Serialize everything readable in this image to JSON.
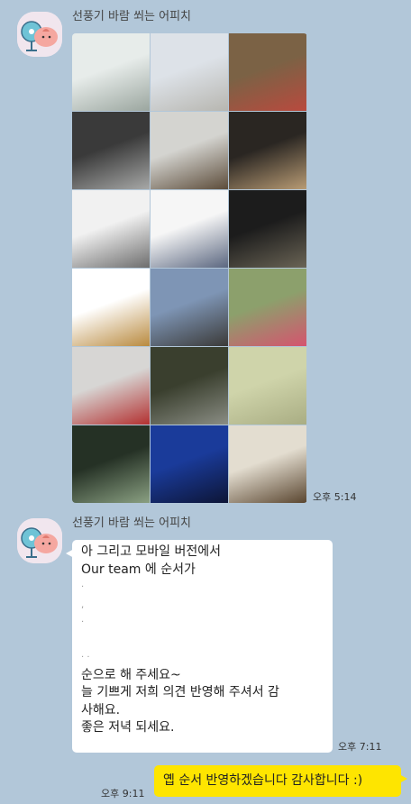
{
  "messages": [
    {
      "sender": "선풍기 바람 쐬는 어피치",
      "avatar_icon": "apeach-fan-icon",
      "time": "오후 5:14",
      "photos": [
        {
          "name": "birds-sky-photo",
          "c1": "#e7ecea",
          "c2": "#9ba69f"
        },
        {
          "name": "cloudy-rooftop-photo",
          "c1": "#dde2e8",
          "c2": "#b7b6b0"
        },
        {
          "name": "window-shutter-photo",
          "c1": "#7b6245",
          "c2": "#b94a3e"
        },
        {
          "name": "gallery-wall-photo",
          "c1": "#3a3a3a",
          "c2": "#a7a8a7"
        },
        {
          "name": "head-sculpture-photo",
          "c1": "#d4d4d0",
          "c2": "#5c4c3a"
        },
        {
          "name": "hand-dark-photo",
          "c1": "#2a2622",
          "c2": "#b89b74"
        },
        {
          "name": "snow-lines-photo",
          "c1": "#f1f1f1",
          "c2": "#6d6d6d"
        },
        {
          "name": "snow-field-photo",
          "c1": "#f6f6f6",
          "c2": "#5b6780"
        },
        {
          "name": "dark-hall-photo",
          "c1": "#1c1c1c",
          "c2": "#6a6455"
        },
        {
          "name": "sand-horizon-photo",
          "c1": "#ffffff",
          "c2": "#b98a3f"
        },
        {
          "name": "aerial-city-photo",
          "c1": "#7e95b5",
          "c2": "#3b3a38"
        },
        {
          "name": "flowers-photo",
          "c1": "#8ca06c",
          "c2": "#d5546f"
        },
        {
          "name": "red-mailbox-photo",
          "c1": "#d7d6d4",
          "c2": "#b33030"
        },
        {
          "name": "forest-bench-photo",
          "c1": "#3a3f2e",
          "c2": "#8a8d84"
        },
        {
          "name": "pale-field-photo",
          "c1": "#cfd4aa",
          "c2": "#a9ad83"
        },
        {
          "name": "bamboo-forest-photo",
          "c1": "#253125",
          "c2": "#8aa082"
        },
        {
          "name": "night-buildings-photo",
          "c1": "#1a3b9a",
          "c2": "#0d1536"
        },
        {
          "name": "rocky-ground-photo",
          "c1": "#e3ddd0",
          "c2": "#5a4630"
        }
      ]
    },
    {
      "sender": "선풍기 바람 쐬는 어피치",
      "avatar_icon": "apeach-fan-icon",
      "time": "오후 7:11",
      "lines": [
        "아 그리고 모바일 버전에서",
        "Our team 에 순서가",
        "·",
        ",",
        "·",
        "",
        "·  ·",
        "순으로 해 주세요~",
        "늘 기쁘게 저희 의견 반영해 주셔서 감",
        "사해요.",
        "좋은 저녁 되세요."
      ]
    },
    {
      "mine": true,
      "time": "오후 9:11",
      "text": "옙 순서 반영하겠습니다 감사합니다 :)"
    }
  ],
  "colors": {
    "background": "#b2c7d9",
    "my_bubble": "#fee500",
    "their_bubble": "#ffffff"
  }
}
